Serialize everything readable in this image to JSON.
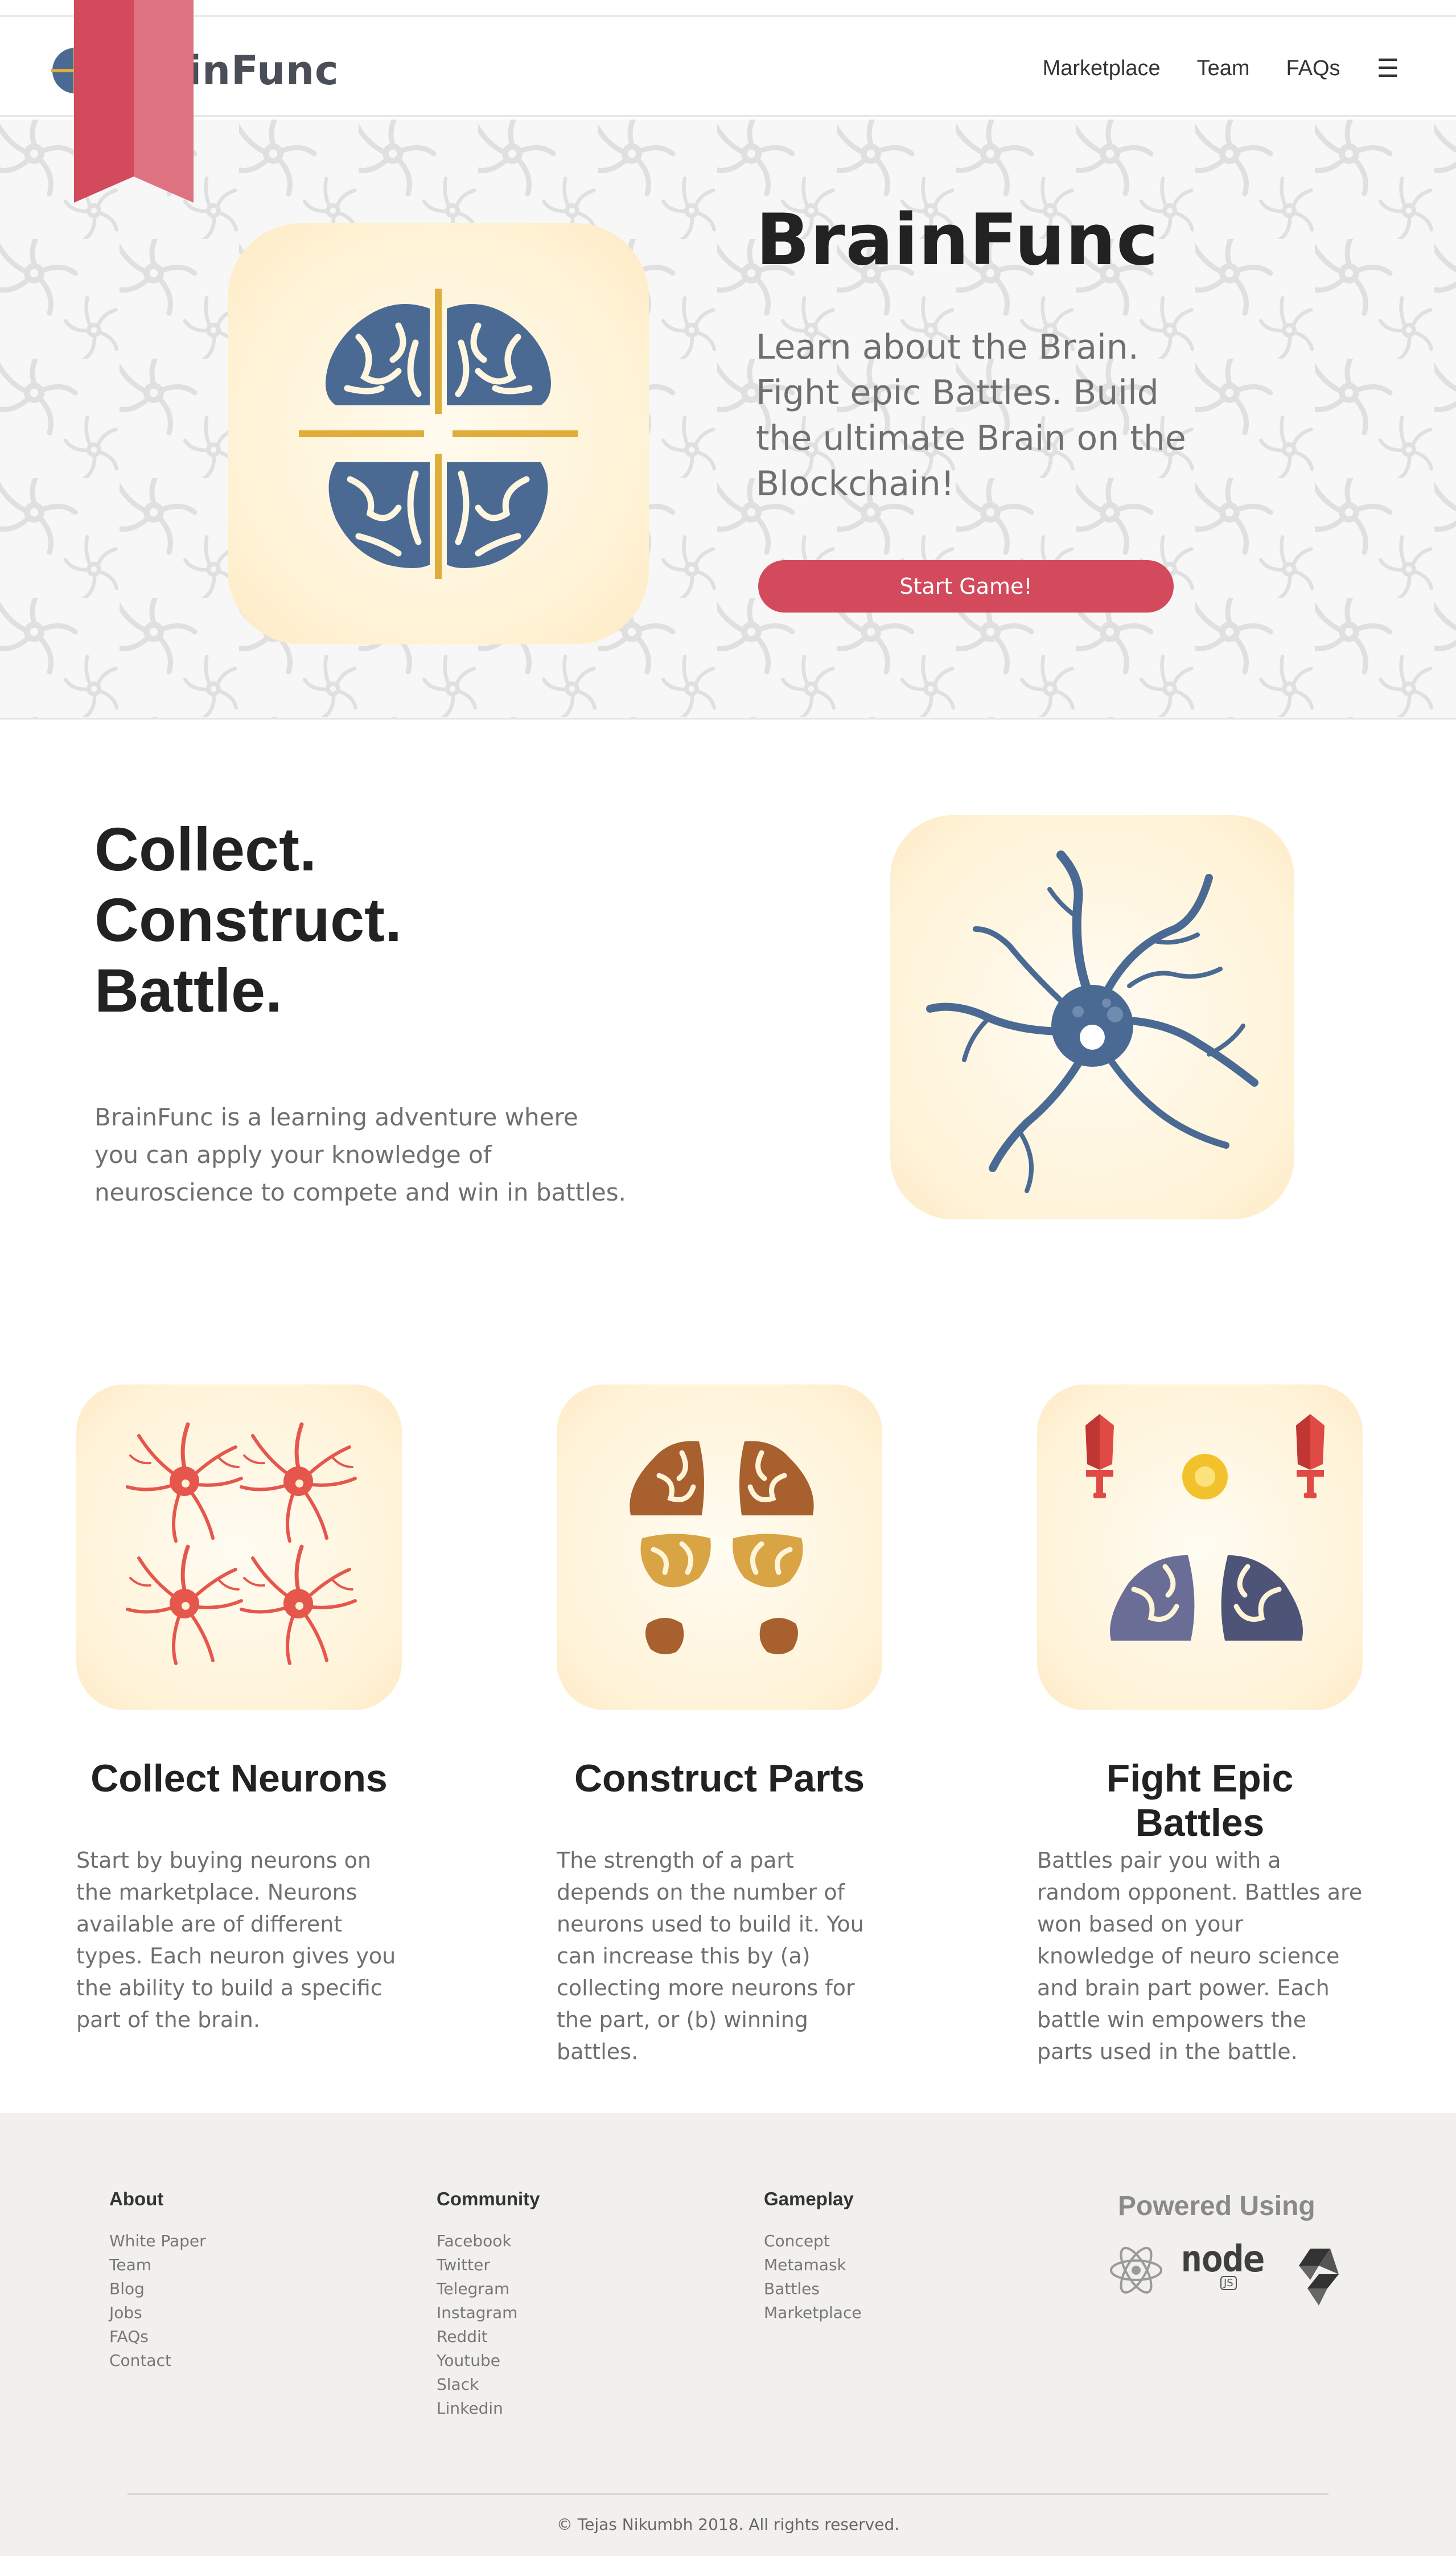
{
  "brand": {
    "name": "BrainFunc"
  },
  "nav": {
    "items": [
      "Marketplace",
      "Team",
      "FAQs"
    ],
    "menu_icon": "hamburger-icon"
  },
  "hero": {
    "title": "BrainFunc",
    "subtitle": "Learn about the Brain. Fight epic Battles. Build the ultimate Brain on the Blockchain!",
    "cta": "Start Game!"
  },
  "intro": {
    "heading_lines": [
      "Collect.",
      "Construct.",
      "Battle."
    ],
    "description": "BrainFunc is a learning adventure where you can apply your knowledge of neuroscience to compete and win in battles."
  },
  "features": [
    {
      "title": "Collect Neurons",
      "description": "Start by buying neurons on the marketplace. Neurons available are of different types. Each neuron gives you the ability to build a specific part of the brain."
    },
    {
      "title": "Construct Parts",
      "description": "The strength of a part depends on the number of neurons used to build it. You can increase this by (a) collecting more neurons for the part, or (b) winning battles."
    },
    {
      "title": "Fight Epic Battles",
      "description": "Battles pair you with a random opponent. Battles are won based on your knowledge of neuro science and brain part power. Each battle win empowers the parts used in the battle."
    }
  ],
  "footer": {
    "columns": [
      {
        "title": "About",
        "links": [
          "White Paper",
          "Team",
          "Blog",
          "Jobs",
          "FAQs",
          "Contact"
        ]
      },
      {
        "title": "Community",
        "links": [
          "Facebook",
          "Twitter",
          "Telegram",
          "Instagram",
          "Reddit",
          "Youtube",
          "Slack",
          "Linkedin"
        ]
      },
      {
        "title": "Gameplay",
        "links": [
          "Concept",
          "Metamask",
          "Battles",
          "Marketplace"
        ]
      }
    ],
    "powered_title": "Powered Using",
    "tech_icons": [
      "react-icon",
      "node-icon",
      "solidity-icon"
    ],
    "tech_labels": {
      "node": "node",
      "node_badge": "JS"
    },
    "copyright": "© Tejas Nikumbh 2018. All rights reserved."
  },
  "colors": {
    "accent": "#d24a5c",
    "brain_blue": "#4a6a93",
    "gold": "#e0ad3a",
    "neuron_red": "#e5574d",
    "tile_cream": "#fff3d8",
    "footer_bg": "#f1f0ec"
  }
}
